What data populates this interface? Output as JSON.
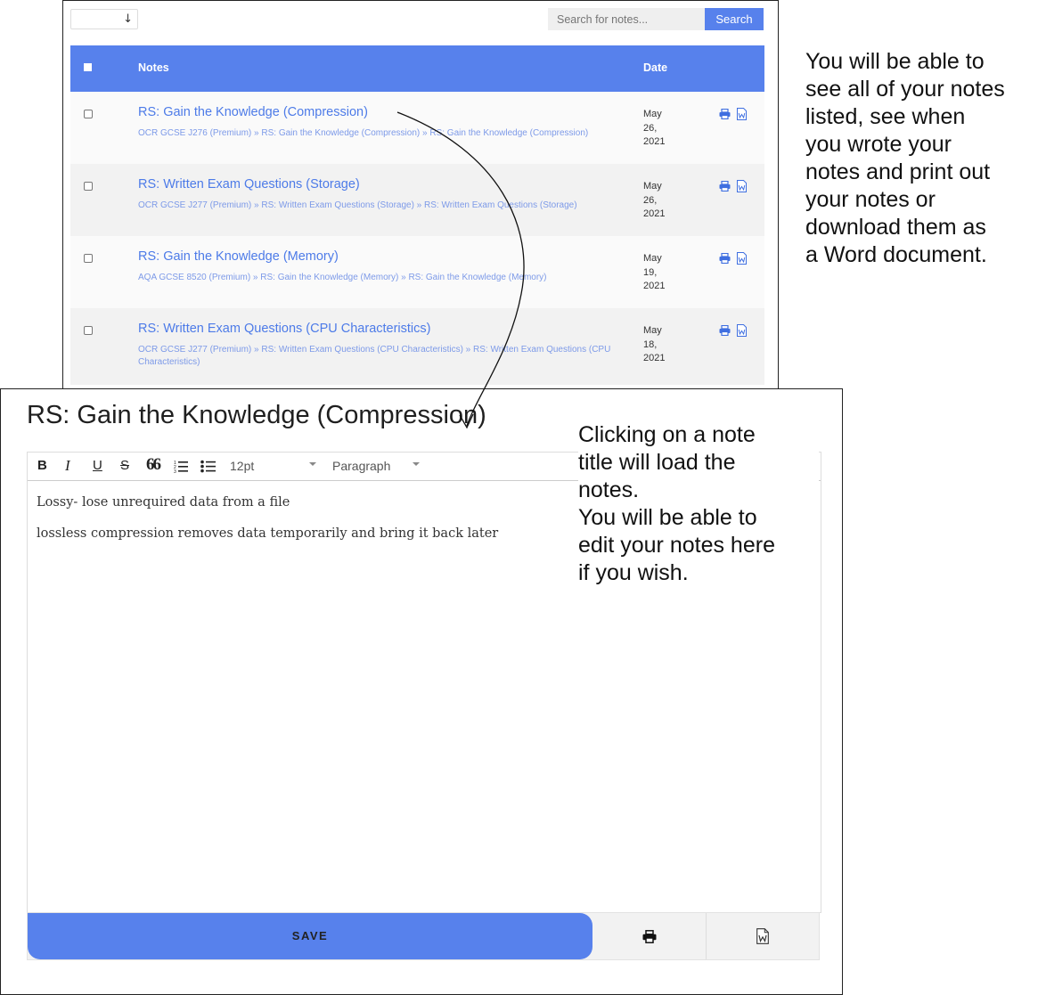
{
  "list": {
    "sort_arrow": "↓",
    "search_placeholder": "Search for notes...",
    "search_label": "Search",
    "headers": {
      "notes": "Notes",
      "date": "Date"
    },
    "rows": [
      {
        "title": "RS: Gain the Knowledge (Compression)",
        "breadcrumb": "OCR GCSE J276 (Premium) » RS: Gain the Knowledge (Compression) » RS: Gain the Knowledge (Compression)",
        "date_line1": "May",
        "date_line2": "26,",
        "date_line3": "2021"
      },
      {
        "title": "RS: Written Exam Questions (Storage)",
        "breadcrumb": "OCR GCSE J277 (Premium) » RS: Written Exam Questions (Storage) » RS: Written Exam Questions (Storage)",
        "date_line1": "May",
        "date_line2": "26,",
        "date_line3": "2021"
      },
      {
        "title": "RS: Gain the Knowledge (Memory)",
        "breadcrumb": "AQA GCSE 8520 (Premium) » RS: Gain the Knowledge (Memory) » RS: Gain the Knowledge (Memory)",
        "date_line1": "May",
        "date_line2": "19,",
        "date_line3": "2021"
      },
      {
        "title": "RS: Written Exam Questions (CPU Characteristics)",
        "breadcrumb": "OCR GCSE J277 (Premium) » RS: Written Exam Questions (CPU Characteristics) » RS: Written Exam Questions (CPU Characteristics)",
        "date_line1": "May",
        "date_line2": "18,",
        "date_line3": "2021"
      }
    ]
  },
  "captions": {
    "right": "You will be able to\nsee all of your notes\nlisted, see when\nyou wrote your\nnotes and print out\nyour notes or\ndownload them as\na Word document.",
    "middle": "Clicking on a note\ntitle will load the\nnotes.\nYou will be able to\nedit your notes here\nif you wish."
  },
  "editor": {
    "title": "RS: Gain the Knowledge (Compression)",
    "toolbar": {
      "bold": "B",
      "italic": "I",
      "underline": "U",
      "strike": "S",
      "quote": "66",
      "font_size": "12pt",
      "block_format": "Paragraph"
    },
    "content": [
      "Lossy- lose unrequired data from a file",
      "lossless compression removes data temporarily and bring it back later"
    ],
    "save_label": "SAVE"
  },
  "colors": {
    "accent": "#5781ec",
    "link": "#4d7be8"
  }
}
